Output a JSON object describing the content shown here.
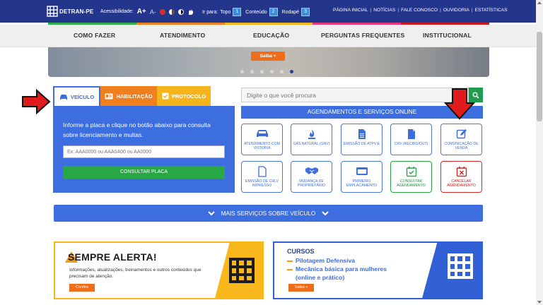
{
  "topbar": {
    "logo_text": "DETRAN-PE",
    "accessibility_label": "Acessibilidade:",
    "font_increase": "A+",
    "font_decrease": "A-",
    "goto_label": "Ir para:",
    "goto": [
      {
        "label": "Topo",
        "num": "1"
      },
      {
        "label": "Conteúdo",
        "num": "2"
      },
      {
        "label": "Rodapé",
        "num": "3"
      }
    ],
    "links": [
      "PÁGINA INICIAL",
      "NOTÍCIAS",
      "FALE CONOSCO",
      "OUVIDORIA",
      "ESTATÍSTICAS"
    ],
    "colors": [
      "#2fae4a",
      "#f07f1e",
      "#f6b51a",
      "#e6357a",
      "#c41c1c"
    ]
  },
  "nav": {
    "items": [
      "COMO FAZER",
      "ATENDIMENTO",
      "EDUCAÇÃO",
      "PERGUNTAS FREQUENTES",
      "INSTITUCIONAL"
    ]
  },
  "banner": {
    "button": "Saiba +"
  },
  "vehicle": {
    "tabs": [
      {
        "label": "VEÍCULO",
        "icon": "car-icon"
      },
      {
        "label": "HABILITAÇÃO",
        "icon": "id-card-icon"
      },
      {
        "label": "PROTOCOLO",
        "icon": "check-square-icon"
      }
    ],
    "instruction": "Informe a placa e clique no botão abaixo para consulta sobre licenciamento e multas.",
    "plate_placeholder": "Ex: AAA0000 ou AAA0A00 ou AA0000",
    "button": "CONSULTAR PLACA"
  },
  "search": {
    "placeholder": "Digite o que você procura"
  },
  "services": {
    "header": "AGENDAMENTOS E SERVIÇOS ONLINE",
    "items": [
      "ATENDIMENTO COM VISTORIA",
      "GÁS NATURAL (GNV)",
      "EMISSÃO DE ATPV-E",
      "CRV (RECIBO/DUT)",
      "COMUNICAÇÃO DE VENDA",
      "EMISSÃO DE CRLV IMPRESSO",
      "MUDANÇA DE PROPRIETÁRIO",
      "PRIMEIRO EMPLACAMENTO",
      "CONSULTAR AGENDAMENTO",
      "CANCELAR AGENDAMENTO"
    ]
  },
  "more": {
    "label": "MAIS SERVIÇOS SOBRE VEÍCULO"
  },
  "alert_card": {
    "title": "SEMPRE ALERTA!",
    "text": "Informações, atualizações, treinamentos e outros conteúdos que precisam de atenção.",
    "button": "Confira"
  },
  "courses_card": {
    "title": "CURSOS",
    "items": [
      "Pilotagem Defensiva",
      "Mecânica básica para mulheres",
      "(online e prático)"
    ],
    "button": "Saiba +"
  }
}
